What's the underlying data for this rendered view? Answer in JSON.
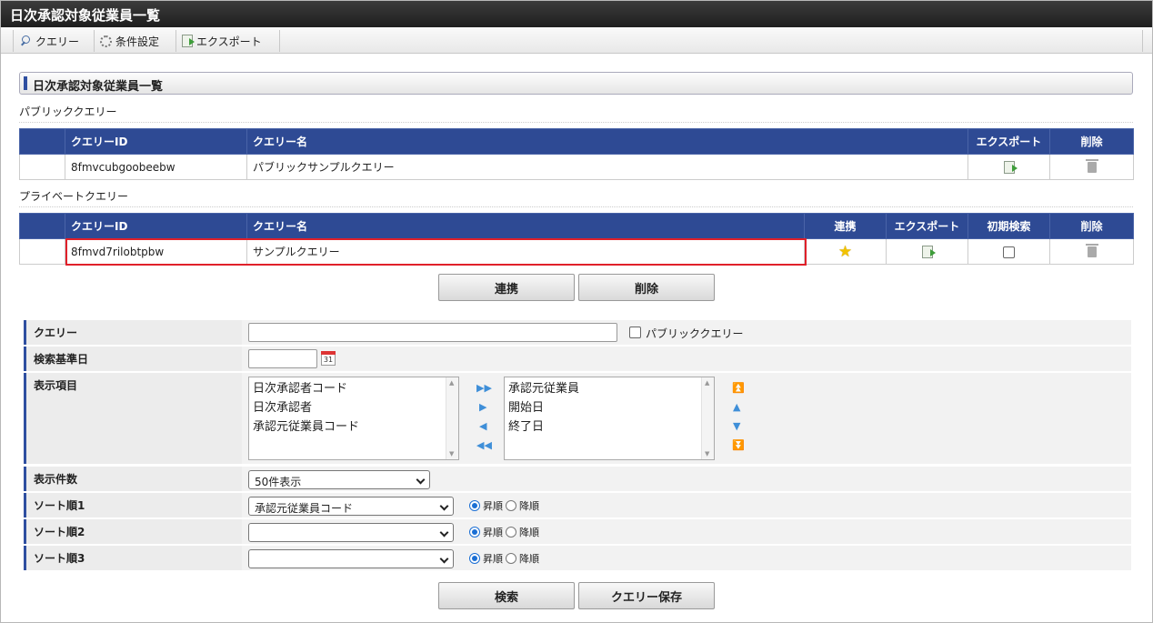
{
  "window": {
    "title": "日次承認対象従業員一覧"
  },
  "toolbar": {
    "query": "クエリー",
    "conditions": "条件設定",
    "export": "エクスポート"
  },
  "section": {
    "title": "日次承認対象従業員一覧"
  },
  "public": {
    "label": "パブリッククエリー",
    "headers": {
      "id": "クエリーID",
      "name": "クエリー名",
      "export": "エクスポート",
      "delete": "削除"
    },
    "rows": [
      {
        "id": "8fmvcubgoobeebw",
        "name": "パブリックサンプルクエリー"
      }
    ]
  },
  "private": {
    "label": "プライベートクエリー",
    "headers": {
      "id": "クエリーID",
      "name": "クエリー名",
      "link": "連携",
      "export": "エクスポート",
      "initial": "初期検索",
      "delete": "削除"
    },
    "rows": [
      {
        "id": "8fmvd7rilobtpbw",
        "name": "サンプルクエリー"
      }
    ]
  },
  "actions": {
    "link": "連携",
    "delete": "削除",
    "search": "検索",
    "save": "クエリー保存"
  },
  "form": {
    "query_label": "クエリー",
    "public_check": "パブリッククエリー",
    "base_date_label": "検索基準日",
    "calendar_day": "31",
    "display_items_label": "表示項目",
    "available_items": [
      "日次承認者コード",
      "日次承認者",
      "承認元従業員コード"
    ],
    "selected_items": [
      "承認元従業員",
      "開始日",
      "終了日"
    ],
    "count_label": "表示件数",
    "count_value": "50件表示",
    "sort1_label": "ソート順1",
    "sort1_value": "承認元従業員コード",
    "sort2_label": "ソート順2",
    "sort3_label": "ソート順3",
    "asc": "昇順",
    "desc": "降順"
  },
  "colors": {
    "header": "#2e4a94",
    "highlight": "#e0202a",
    "star": "#f2c200"
  }
}
